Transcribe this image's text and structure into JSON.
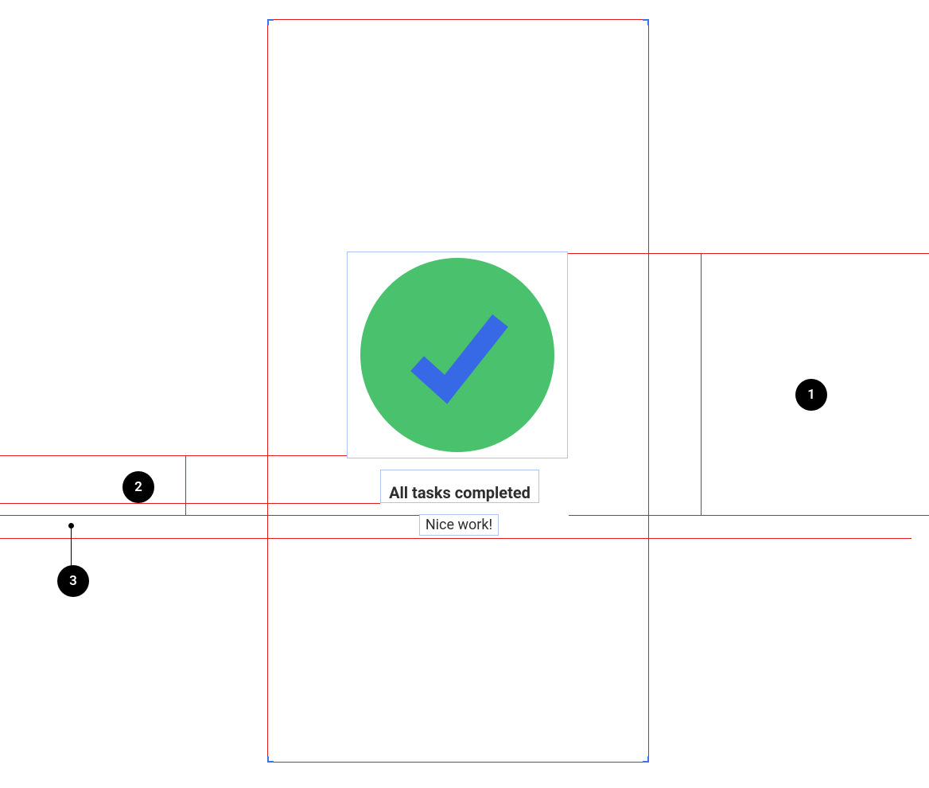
{
  "status": {
    "title": "All tasks completed",
    "subtitle": "Nice work!",
    "icon_name": "checkmark-circle"
  },
  "annotations": {
    "badge_1": "1",
    "badge_2": "2",
    "badge_3": "3"
  },
  "colors": {
    "circle_fill": "#4ac16d",
    "check_stroke": "#3768e5",
    "guide_red": "#e01b1b",
    "selection_blue": "#b0c3f0"
  }
}
